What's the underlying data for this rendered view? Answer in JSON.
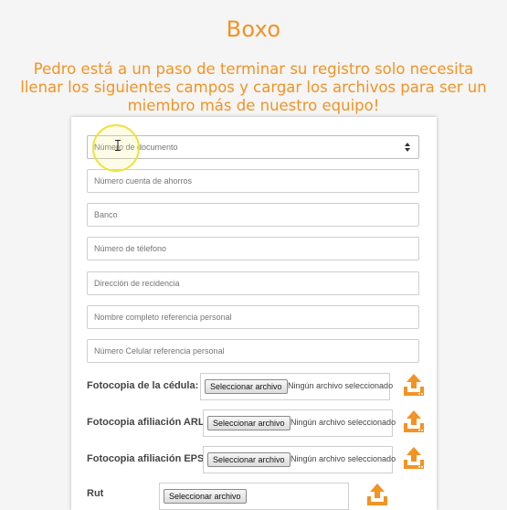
{
  "header": {
    "title": "Boxo",
    "subtitle": "Pedro está a un paso de terminar su registro solo necesita llenar los siguientes campos y cargar los archivos para ser un miembro más de nuestro equipo!"
  },
  "form": {
    "document_type": {
      "placeholder": "Número de documento"
    },
    "fields": [
      {
        "placeholder": "Número cuenta de ahorros"
      },
      {
        "placeholder": "Banco"
      },
      {
        "placeholder": "Número de télefono"
      },
      {
        "placeholder": "Dirección de recidencia"
      },
      {
        "placeholder": "Nombre completo referencia personal"
      },
      {
        "placeholder": "Número Celular referencia personal"
      }
    ],
    "uploads": [
      {
        "label": "Fotocopia de la cédula:",
        "button": "Seleccionar archivo",
        "status": "Ningún archivo seleccionado"
      },
      {
        "label": "Fotocopia afiliación ARL:",
        "button": "Seleccionar archivo",
        "status": "Ningún archivo seleccionado"
      },
      {
        "label": "Fotocopia afiliación EPS:",
        "button": "Seleccionar archivo",
        "status": "Ningún archivo seleccionado"
      },
      {
        "label": "Rut",
        "button": "Seleccionar archivo",
        "status": ""
      }
    ]
  },
  "colors": {
    "accent": "#f29324",
    "cursor_highlight": "#eee23a"
  },
  "icons": {
    "upload": "upload-icon",
    "select": "select-arrows-icon"
  }
}
